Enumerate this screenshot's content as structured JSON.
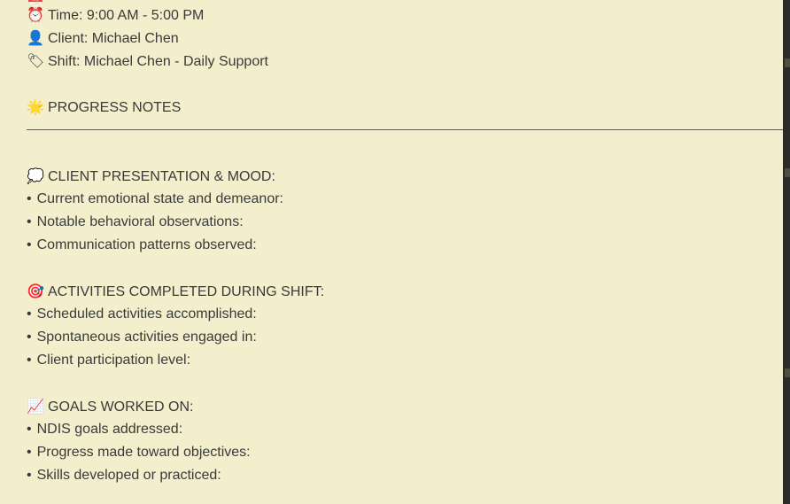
{
  "details": {
    "time_icon": "alarm-clock-icon",
    "time_text": "Time: 9:00 AM - 5:00 PM",
    "client_icon": "person-silhouette-icon",
    "client_text": "Client: Michael Chen",
    "shift_icon": "tag-label-icon",
    "shift_text": "Shift: Michael Chen - Daily Support"
  },
  "progress_notes": {
    "icon": "glowing-star-icon",
    "heading": "PROGRESS NOTES"
  },
  "sections": [
    {
      "icon": "thought-bubble-icon",
      "heading": "CLIENT PRESENTATION & MOOD:",
      "items": [
        "Current emotional state and demeanor:",
        "Notable behavioral observations:",
        "Communication patterns observed:"
      ]
    },
    {
      "icon": "bullseye-target-icon",
      "heading": "ACTIVITIES COMPLETED DURING SHIFT:",
      "items": [
        "Scheduled activities accomplished:",
        "Spontaneous activities engaged in:",
        "Client participation level:"
      ]
    },
    {
      "icon": "chart-increasing-icon",
      "heading": "GOALS WORKED ON:",
      "items": [
        "NDIS goals addressed:",
        "Progress made toward objectives:",
        "Skills developed or practiced:"
      ]
    }
  ],
  "bullet_char": "•",
  "colors": {
    "background": "#f3eecc",
    "text": "#3a3a3a"
  }
}
